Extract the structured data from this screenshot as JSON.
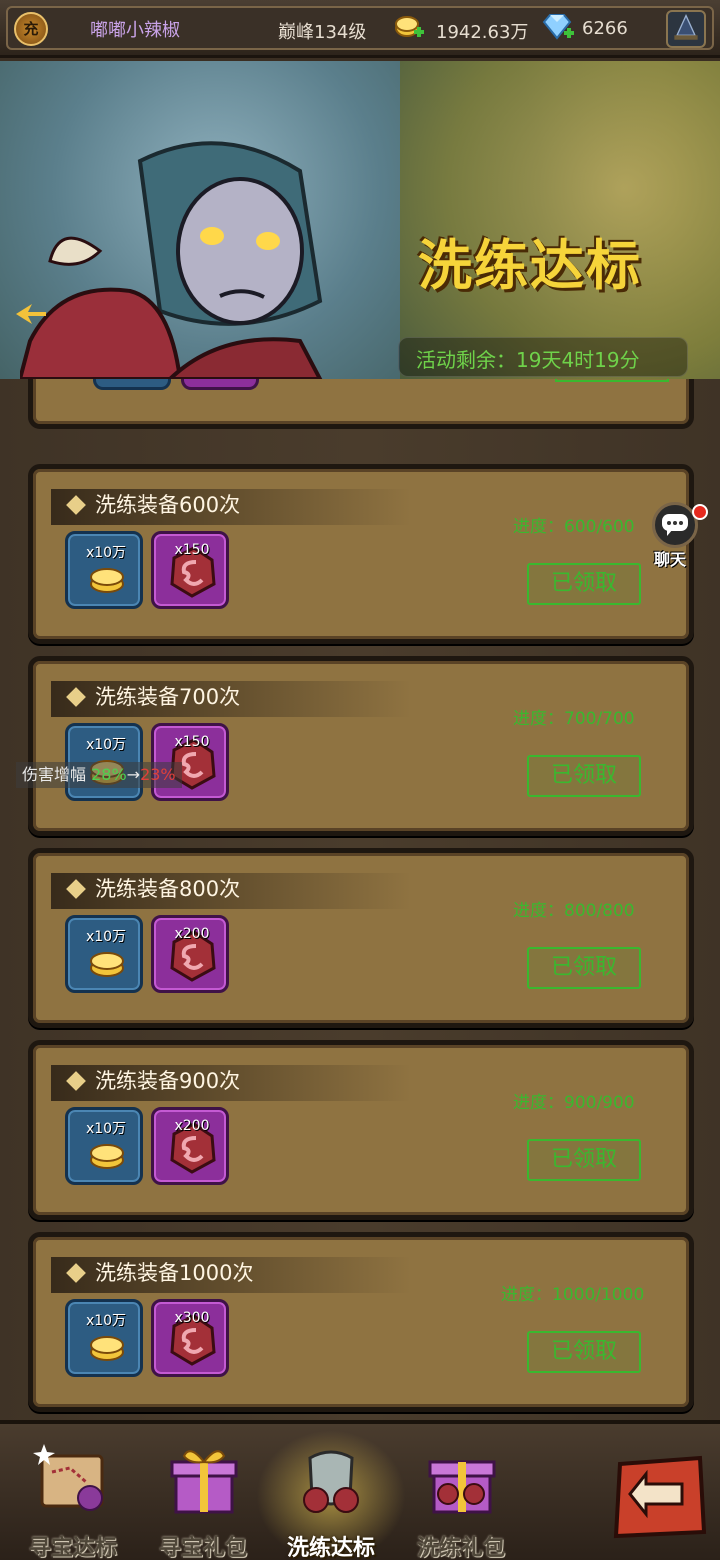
{
  "topbar": {
    "recharge_label": "充",
    "player_name": "嘟嘟小辣椒",
    "level": "巅峰134级",
    "gold": "1942.63万",
    "gems": "6266"
  },
  "banner": {
    "title": "洗练达标",
    "timer": "活动剩余：19天4时19分"
  },
  "tasks": [
    {
      "title": "洗练装备600次",
      "progress": "进度：600/600",
      "gold_count": "x10万",
      "gem_count": "x150",
      "button": "已领取"
    },
    {
      "title": "洗练装备700次",
      "progress": "进度：700/700",
      "gold_count": "x10万",
      "gem_count": "x150",
      "button": "已领取"
    },
    {
      "title": "洗练装备800次",
      "progress": "进度：800/800",
      "gold_count": "x10万",
      "gem_count": "x200",
      "button": "已领取"
    },
    {
      "title": "洗练装备900次",
      "progress": "进度：900/900",
      "gold_count": "x10万",
      "gem_count": "x200",
      "button": "已领取"
    },
    {
      "title": "洗练装备1000次",
      "progress": "进度：1000/1000",
      "gold_count": "x10万",
      "gem_count": "x300",
      "button": "已领取"
    }
  ],
  "chat": {
    "label": "聊天"
  },
  "tooltip": {
    "label": "伤害增幅 ",
    "old": "28%",
    "arrow": "→",
    "new": "23%"
  },
  "nav": {
    "items": [
      {
        "label": "寻宝达标",
        "active": false
      },
      {
        "label": "寻宝礼包",
        "active": false
      },
      {
        "label": "洗练达标",
        "active": true
      },
      {
        "label": "洗练礼包",
        "active": false
      }
    ]
  },
  "colors": {
    "progress_green": "#3ab82f",
    "title_gold": "#f6d43a",
    "card_brown": "#8f7341"
  }
}
